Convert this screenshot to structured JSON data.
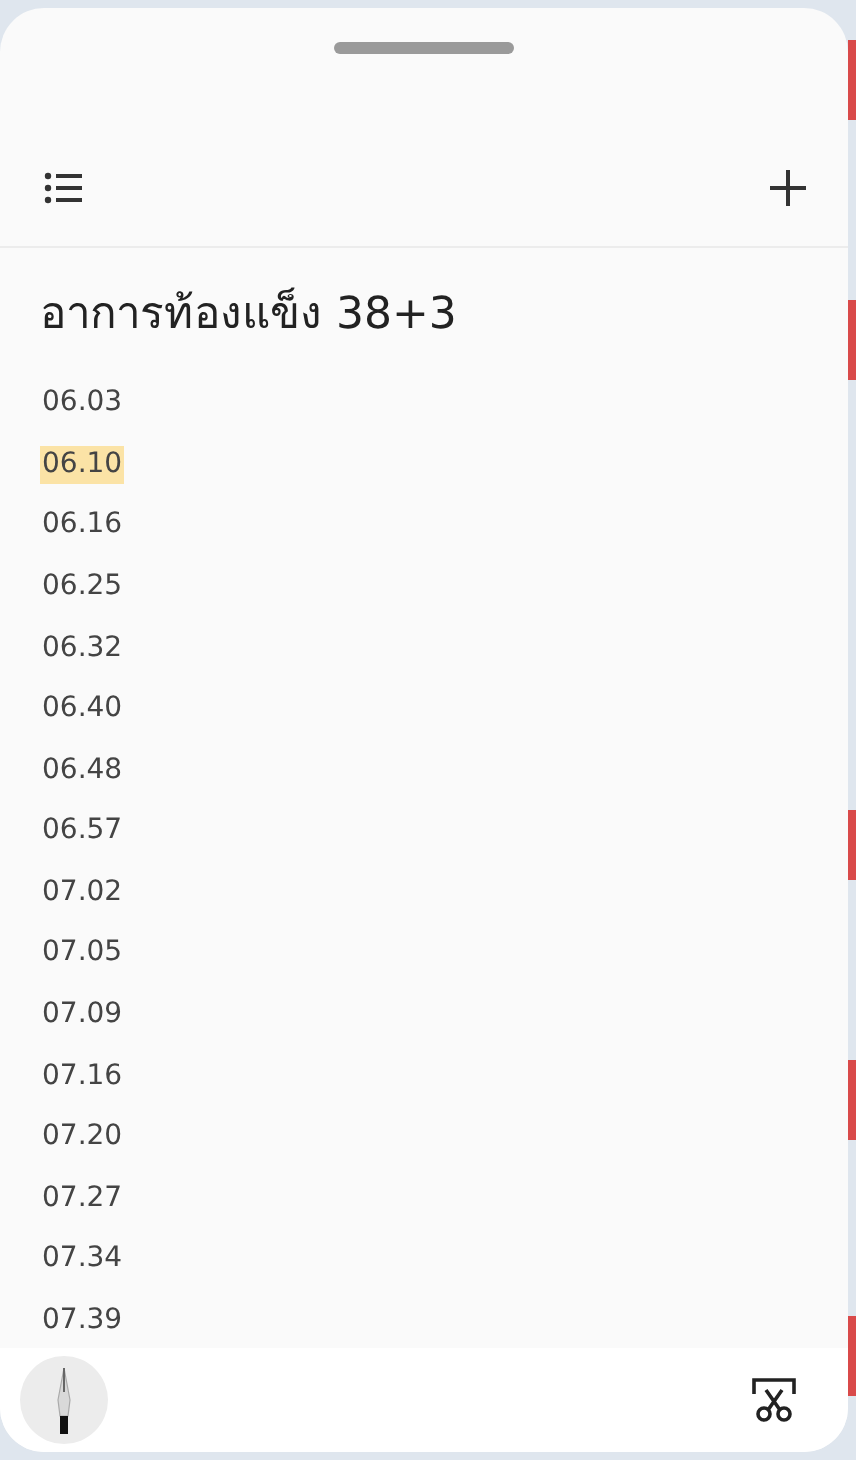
{
  "title": "อาการท้องแข็ง 38+3",
  "lines": [
    {
      "text": "06.03",
      "highlighted": false
    },
    {
      "text": "06.10",
      "highlighted": true
    },
    {
      "text": "06.16",
      "highlighted": false
    },
    {
      "text": "06.25",
      "highlighted": false
    },
    {
      "text": "06.32",
      "highlighted": false
    },
    {
      "text": "06.40",
      "highlighted": false
    },
    {
      "text": "06.48",
      "highlighted": false
    },
    {
      "text": "06.57",
      "highlighted": false
    },
    {
      "text": "07.02",
      "highlighted": false
    },
    {
      "text": "07.05",
      "highlighted": false
    },
    {
      "text": "07.09",
      "highlighted": false
    },
    {
      "text": "07.16",
      "highlighted": false
    },
    {
      "text": "07.20",
      "highlighted": false
    },
    {
      "text": "07.27",
      "highlighted": false
    },
    {
      "text": "07.34",
      "highlighted": false
    },
    {
      "text": "07.39",
      "highlighted": false
    }
  ]
}
